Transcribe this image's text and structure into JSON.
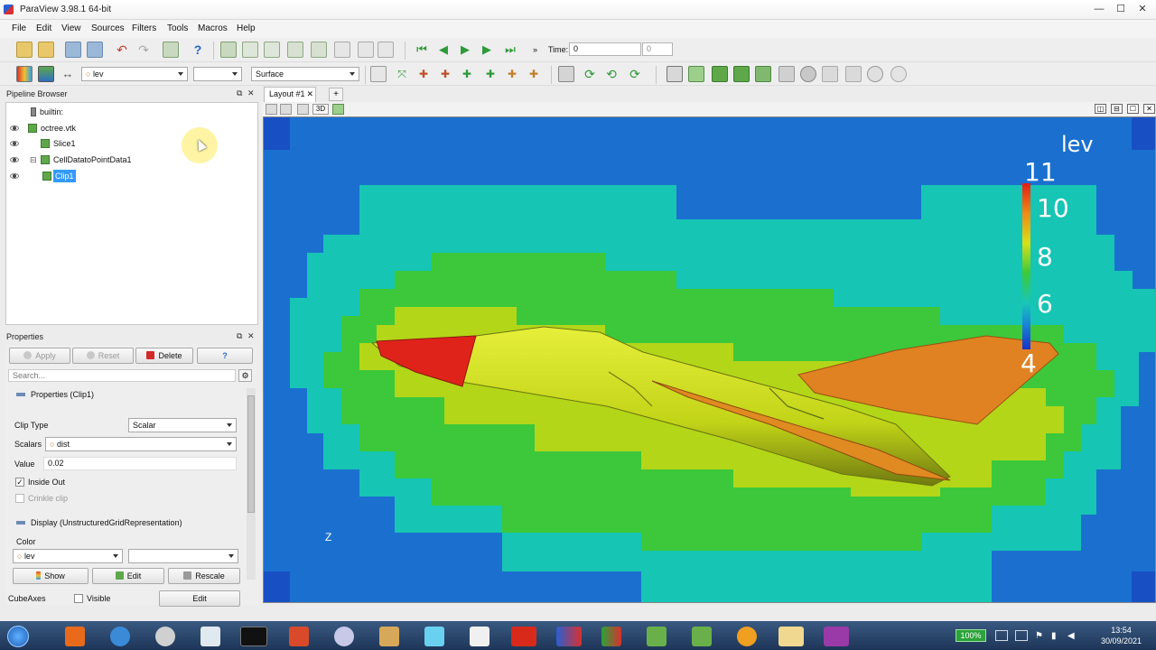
{
  "window": {
    "title": "ParaView 3.98.1 64-bit",
    "minimize": "—",
    "maximize": "☐",
    "close": "✕"
  },
  "menu": [
    "File",
    "Edit",
    "View",
    "Sources",
    "Filters",
    "Tools",
    "Macros",
    "Help"
  ],
  "toolbar": {
    "time_label": "Time:",
    "time_value": "0",
    "time_step": "0",
    "color_array": "lev",
    "component": "",
    "representation": "Surface",
    "more": "»"
  },
  "pipeline": {
    "title": "Pipeline Browser",
    "items": [
      {
        "label": "builtin:"
      },
      {
        "label": "octree.vtk"
      },
      {
        "label": "Slice1"
      },
      {
        "label": "CellDatatoPointData1"
      },
      {
        "label": "Clip1"
      }
    ]
  },
  "properties": {
    "title": "Properties",
    "apply": "Apply",
    "reset": "Reset",
    "delete": "Delete",
    "help": "?",
    "search_placeholder": "Search...",
    "section_properties": "Properties (Clip1)",
    "clip_type_label": "Clip Type",
    "clip_type_value": "Scalar",
    "scalars_label": "Scalars",
    "scalars_value": "dist",
    "value_label": "Value",
    "value_value": "0.02",
    "inside_out_label": "Inside Out",
    "crinkle_label": "Crinkle clip",
    "section_display": "Display (UnstructuredGridRepresentation)",
    "color_label": "Color",
    "color_value": "lev",
    "color_component": "",
    "show_label": "Show",
    "edit_label": "Edit",
    "rescale_label": "Rescale",
    "cube_axes_label": "CubeAxes",
    "visible_label": "Visible",
    "cube_edit_label": "Edit"
  },
  "view": {
    "tab_label": "Layout #1",
    "tab_close": "✕",
    "add_tab": "+",
    "mode_3d": "3D",
    "axis_label": "Z"
  },
  "colorbar": {
    "title": "lev",
    "ticks": [
      "11",
      "10",
      "8",
      "6",
      "4"
    ]
  },
  "taskbar": {
    "zoom": "100%",
    "time": "13:54",
    "date": "30/09/2021"
  },
  "colors": {
    "deep_blue": "#1a5fbf",
    "mid_blue": "#1b76d4",
    "cyan": "#16c4b5",
    "green": "#38c83a",
    "yellow": "#c4dc18",
    "orange": "#e07a18",
    "red": "#d8221a",
    "selection": "#3399ff"
  }
}
